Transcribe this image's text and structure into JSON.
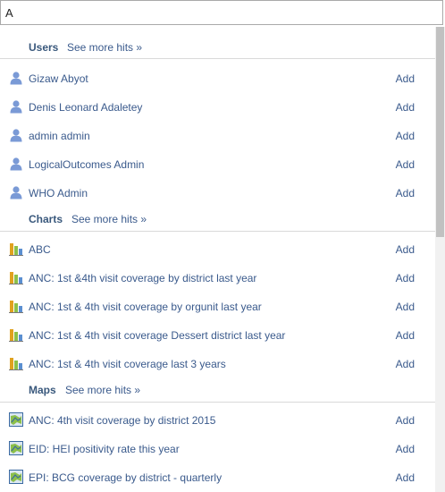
{
  "search": {
    "value": "A",
    "placeholder": ""
  },
  "sections": [
    {
      "title": "Users",
      "see_more": "See more hits »",
      "icon": "user-icon",
      "items": [
        {
          "label": "Gizaw Abyot",
          "action": "Add"
        },
        {
          "label": "Denis Leonard Adaletey",
          "action": "Add"
        },
        {
          "label": "admin admin",
          "action": "Add"
        },
        {
          "label": "LogicalOutcomes Admin",
          "action": "Add"
        },
        {
          "label": "WHO Admin",
          "action": "Add"
        }
      ]
    },
    {
      "title": "Charts",
      "see_more": "See more hits »",
      "icon": "chart-icon",
      "items": [
        {
          "label": "ABC",
          "action": "Add"
        },
        {
          "label": "ANC: 1st &4th visit coverage by district last year",
          "action": "Add"
        },
        {
          "label": "ANC: 1st & 4th visit coverage by orgunit last year",
          "action": "Add"
        },
        {
          "label": "ANC: 1st & 4th visit coverage Dessert district last year",
          "action": "Add"
        },
        {
          "label": "ANC: 1st & 4th visit coverage last 3 years",
          "action": "Add"
        }
      ]
    },
    {
      "title": "Maps",
      "see_more": "See more hits »",
      "icon": "map-icon",
      "items": [
        {
          "label": "ANC: 4th visit coverage by district 2015",
          "action": "Add"
        },
        {
          "label": "EID: HEI positivity rate this year",
          "action": "Add"
        },
        {
          "label": "EPI: BCG coverage by district - quarterly",
          "action": "Add"
        }
      ]
    }
  ],
  "colors": {
    "link": "#3a5a8c",
    "header": "#39587c",
    "divider": "#d9d9d9",
    "user_icon": "#7a9ad6"
  }
}
